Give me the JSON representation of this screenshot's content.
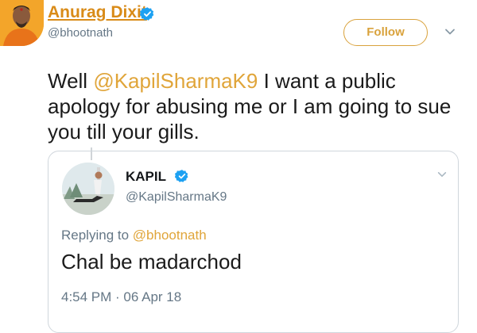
{
  "colors": {
    "accent": "#e0a53a",
    "name_link": "#d98b18",
    "verified": "#1da1f2",
    "secondary_text": "#657786"
  },
  "author": {
    "display_name": "Anurag Dixit",
    "handle": "@bhootnath",
    "verified": true,
    "avatar_icon": "avatar-icon"
  },
  "actions": {
    "follow_label": "Follow",
    "menu_icon": "chevron-down-icon"
  },
  "tweet": {
    "text_before": "Well ",
    "mention": "@KapilSharmaK9",
    "text_after": " I want a public apology for abusing me or I am going to sue you till your gills."
  },
  "quoted": {
    "display_name": "KAPIL",
    "handle": "@KapilSharmaK9",
    "verified": true,
    "replying_prefix": "Replying to ",
    "replying_to": "@bhootnath",
    "text": "Chal be madarchod",
    "timestamp": "4:54 PM · 06 Apr 18"
  }
}
